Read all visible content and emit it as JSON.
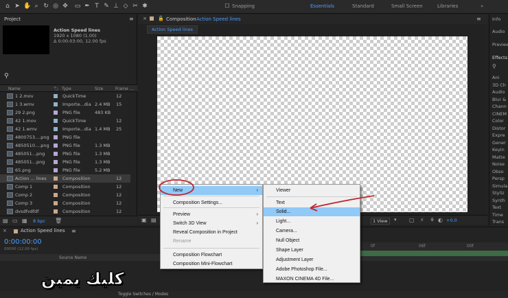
{
  "toolbar": {
    "snapping_label": "Snapping",
    "workspaces": [
      "Essentials",
      "Standard",
      "Small Screen",
      "Libraries"
    ]
  },
  "project": {
    "title": "Project",
    "comp_name": "Action Speed lines",
    "comp_res": "1920 x 1080 (1.00)",
    "comp_dur": "Δ 0:00:03:00, 12.00 fps",
    "bpc": "8 bpc",
    "columns": [
      "Name",
      "Type",
      "Size",
      "Frame ..."
    ],
    "items": [
      {
        "name": "1 2.mov",
        "type": "QuickTime",
        "size": "",
        "fr": "12",
        "color": "#8fb3c9"
      },
      {
        "name": "1 3.wmv",
        "type": "Importe...dia",
        "size": "2.4 MB",
        "fr": "15",
        "color": "#8fb3c9"
      },
      {
        "name": "29 2.png",
        "type": "PNG file",
        "size": "483 KB",
        "fr": "",
        "color": "#b6a7d6"
      },
      {
        "name": "42 1.mov",
        "type": "QuickTime",
        "size": "",
        "fr": "12",
        "color": "#8fb3c9"
      },
      {
        "name": "42 1.wmv",
        "type": "Importe...dia",
        "size": "1.4 MB",
        "fr": "25",
        "color": "#8fb3c9"
      },
      {
        "name": "4800753....png",
        "type": "PNG file",
        "size": "",
        "fr": "",
        "color": "#b6a7d6"
      },
      {
        "name": "4850510....png",
        "type": "PNG file",
        "size": "1.3 MB",
        "fr": "",
        "color": "#b6a7d6"
      },
      {
        "name": "485051...png",
        "type": "PNG file",
        "size": "1.3 MB",
        "fr": "",
        "color": "#b6a7d6"
      },
      {
        "name": "485051...png",
        "type": "PNG file",
        "size": "1.3 MB",
        "fr": "",
        "color": "#b6a7d6"
      },
      {
        "name": "65.png",
        "type": "PNG file",
        "size": "5.2 MB",
        "fr": "",
        "color": "#b6a7d6"
      },
      {
        "name": "Action ... lines",
        "type": "Composition",
        "size": "",
        "fr": "12",
        "color": "#c9a98b"
      },
      {
        "name": "Comp 1",
        "type": "Composition",
        "size": "",
        "fr": "12",
        "color": "#c9a98b"
      },
      {
        "name": "Comp 2",
        "type": "Composition",
        "size": "",
        "fr": "12",
        "color": "#c9a98b"
      },
      {
        "name": "Comp 3",
        "type": "Composition",
        "size": "",
        "fr": "12",
        "color": "#c9a98b"
      },
      {
        "name": "dvsdfvdfdf",
        "type": "Composition",
        "size": "",
        "fr": "12",
        "color": "#c9a98b"
      }
    ]
  },
  "viewer": {
    "tab_prefix": "Composition",
    "tab_name": "Action Speed lines",
    "subtab": "Action Speed lines",
    "view_select": "1 View",
    "exposure": "+0.0"
  },
  "right_panel": {
    "tabs": [
      "Info",
      "Audio",
      "Preview",
      "Effects"
    ],
    "effects": [
      "Ani",
      "3D Ch",
      "Audio",
      "Blur &",
      "Chann",
      "CINEM",
      "Color",
      "Distor",
      "Expre",
      "Gener",
      "Keyin",
      "Matte",
      "Noise",
      "Obso",
      "Persp",
      "Simula",
      "Styliz",
      "Synth",
      "Text",
      "Time",
      "Trans"
    ]
  },
  "timeline": {
    "tab": "Action Speed lines",
    "timecode": "0:00:00:00",
    "fps_line": "00000 (12.00 fps)",
    "source_name": "Source Name",
    "ruler": [
      "0f",
      "06f",
      "00f"
    ],
    "footer": "Toggle Switches / Modes"
  },
  "context_menu": {
    "items": [
      {
        "label": "New",
        "arrow": "›",
        "state": "highlighted"
      },
      {
        "label": "Composition Settings...",
        "state": "normal"
      },
      {
        "label": "Preview",
        "arrow": "›",
        "state": "normal"
      },
      {
        "label": "Switch 3D View",
        "arrow": "›",
        "state": "normal"
      },
      {
        "label": "Reveal Composition in Project",
        "state": "normal"
      },
      {
        "label": "Rename",
        "state": "disabled"
      },
      {
        "label": "Composition Flowchart",
        "state": "normal"
      },
      {
        "label": "Composition Mini-Flowchart",
        "state": "normal"
      }
    ]
  },
  "submenu": {
    "items": [
      {
        "label": "Viewer",
        "state": "normal"
      },
      {
        "label": "Text",
        "state": "normal"
      },
      {
        "label": "Solid...",
        "state": "highlighted"
      },
      {
        "label": "Light...",
        "state": "normal"
      },
      {
        "label": "Camera...",
        "state": "normal"
      },
      {
        "label": "Null Object",
        "state": "normal"
      },
      {
        "label": "Shape Layer",
        "state": "normal"
      },
      {
        "label": "Adjustment Layer",
        "state": "normal"
      },
      {
        "label": "Adobe Photoshop File...",
        "state": "normal"
      },
      {
        "label": "MAXON CINEMA 4D File...",
        "state": "normal"
      }
    ]
  },
  "overlay_caption": "كليك يمين",
  "colors": {
    "accent": "#4a9eff",
    "annotation": "#c0262e",
    "highlight": "#91c9f7"
  }
}
